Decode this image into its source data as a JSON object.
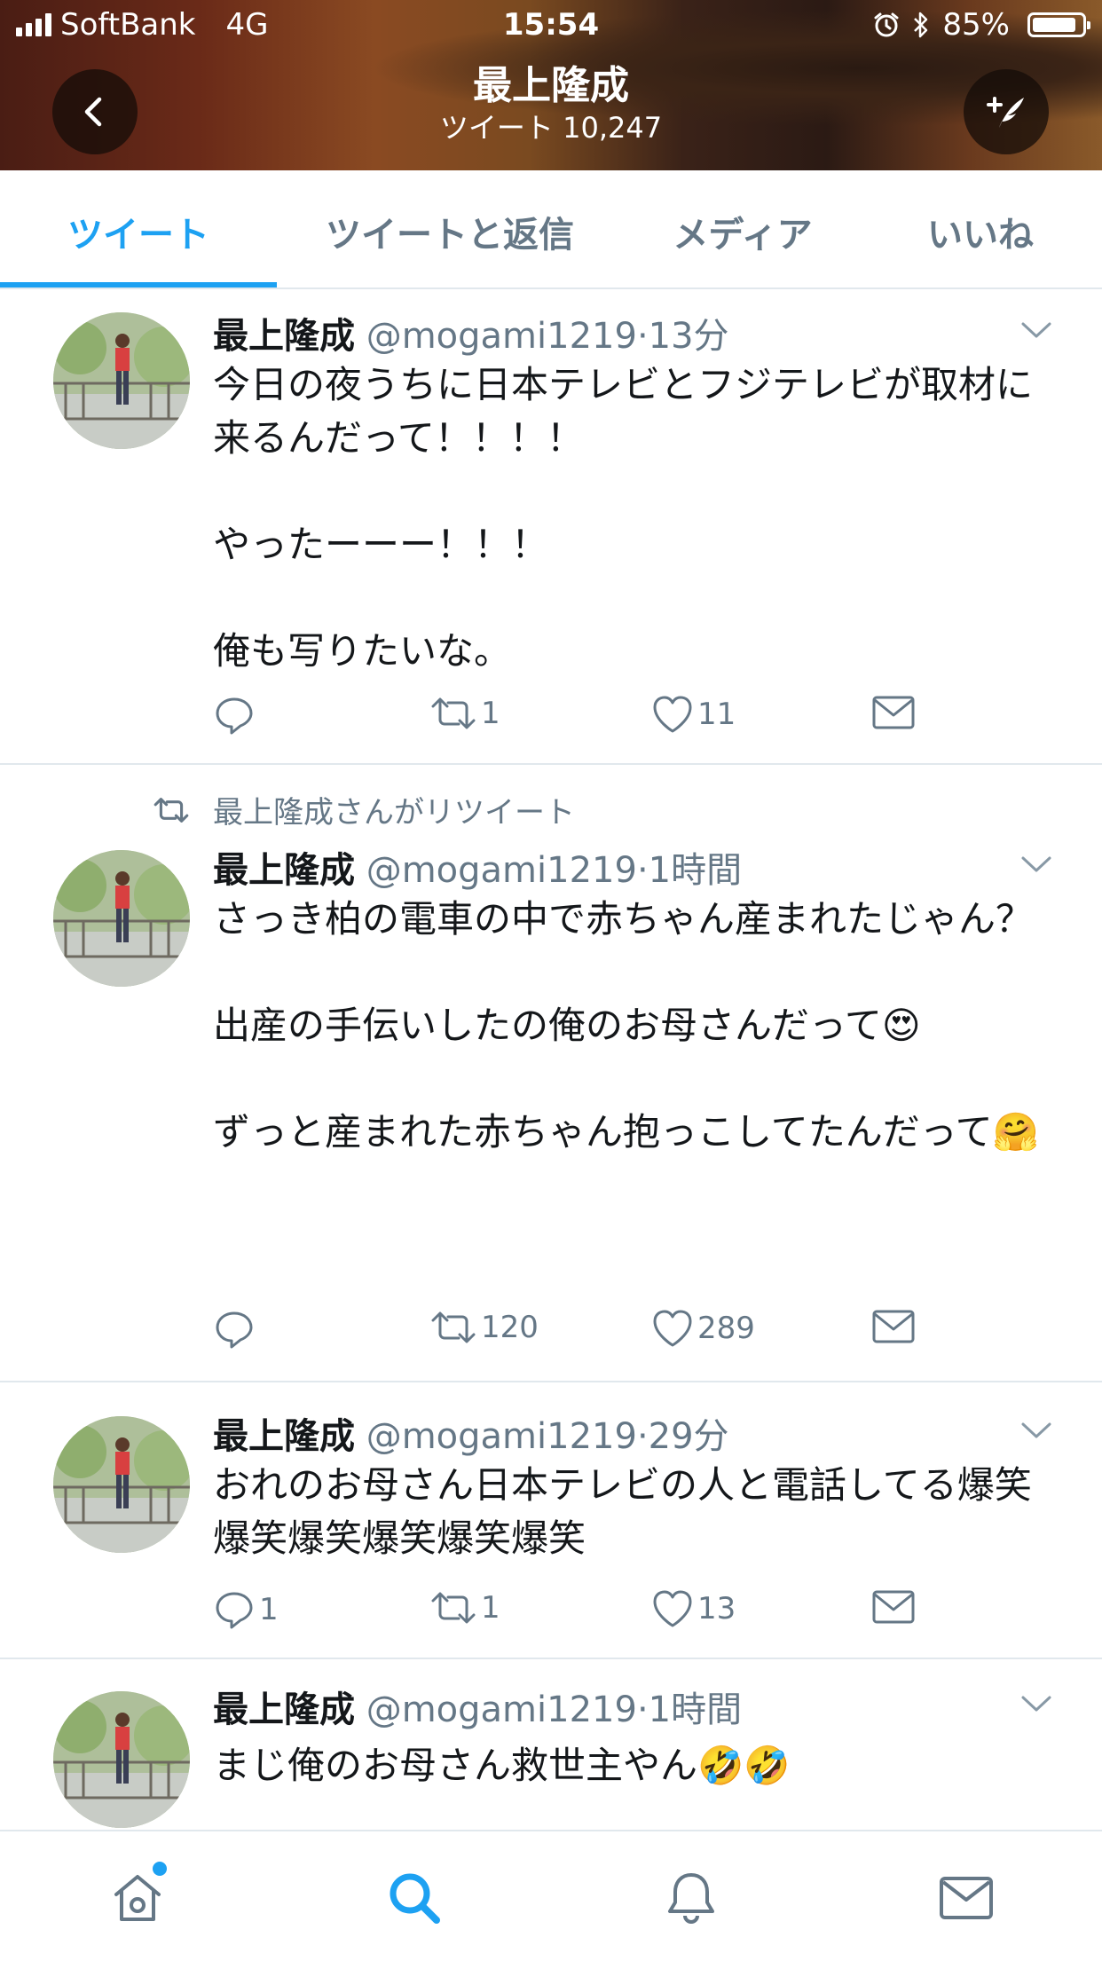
{
  "status_bar": {
    "carrier": "SoftBank",
    "network": "4G",
    "time": "15:54",
    "battery": "85%"
  },
  "header": {
    "name": "最上隆成",
    "tweet_count": "ツイート 10,247"
  },
  "tabs": [
    {
      "label": "ツイート",
      "active": true
    },
    {
      "label": "ツイートと返信",
      "active": false
    },
    {
      "label": "メディア",
      "active": false
    },
    {
      "label": "いいね",
      "active": false
    }
  ],
  "tweets": [
    {
      "display_name": "最上隆成",
      "handle": "@mogami1219",
      "time": "13分",
      "text": "今日の夜うちに日本テレビとフジテレビが取材に来るんだって！！！！\n\nやったーーー！！！\n\n俺も写りたいな。",
      "replies": "",
      "retweets": "1",
      "likes": "11"
    },
    {
      "retweeted_by": "最上隆成さんがリツイート",
      "display_name": "最上隆成",
      "handle": "@mogami1219",
      "time": "1時間",
      "text": "さっき柏の電車の中で赤ちゃん産まれたじゃん？\n\n出産の手伝いしたの俺のお母さんだって😍\n\nずっと産まれた赤ちゃん抱っこしてたんだって🤗",
      "replies": "",
      "retweets": "120",
      "likes": "289"
    },
    {
      "display_name": "最上隆成",
      "handle": "@mogami1219",
      "time": "29分",
      "text": "おれのお母さん日本テレビの人と電話してる爆笑爆笑爆笑爆笑爆笑爆笑",
      "replies": "1",
      "retweets": "1",
      "likes": "13"
    },
    {
      "display_name": "最上隆成",
      "handle": "@mogami1219",
      "time": "1時間",
      "text": "まじ俺のお母さん救世主やん🤣🤣",
      "replies": "",
      "retweets": "",
      "likes": ""
    }
  ],
  "icons": {
    "back": "chevron-left-icon",
    "compose": "compose-tweet-icon",
    "reply": "reply-icon",
    "retweet": "retweet-icon",
    "like": "heart-icon",
    "dm": "envelope-icon",
    "nav_home": "home-icon",
    "nav_search": "search-icon",
    "nav_notifications": "bell-icon",
    "nav_messages": "envelope-icon"
  },
  "colors": {
    "accent": "#1da1f2",
    "secondary_text": "#657786",
    "divider": "#e1e8ed"
  }
}
